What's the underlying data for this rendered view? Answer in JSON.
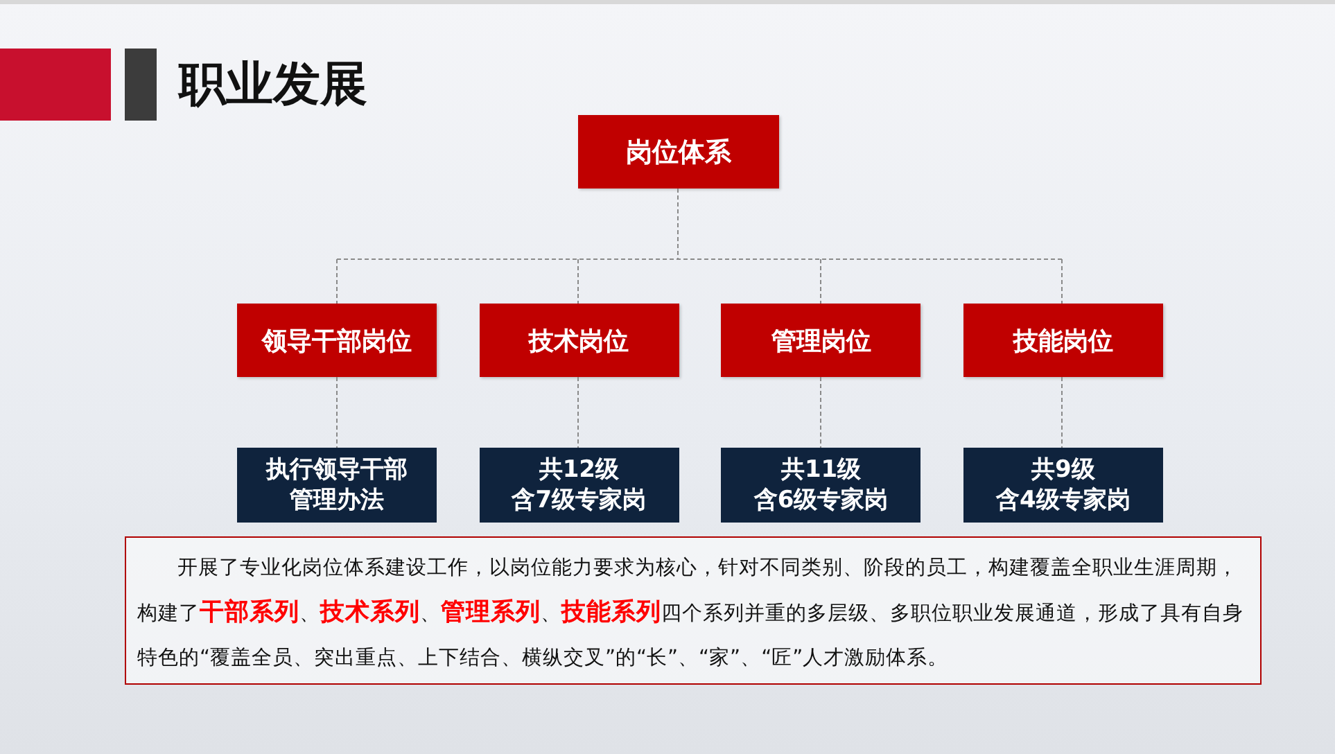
{
  "title": "职业发展",
  "root": "岗位体系",
  "branches": [
    {
      "label": "领导干部岗位",
      "detail": [
        "执行领导干部",
        "管理办法"
      ]
    },
    {
      "label": "技术岗位",
      "detail": [
        "共12级",
        "含7级专家岗"
      ]
    },
    {
      "label": "管理岗位",
      "detail": [
        "共11级",
        "含6级专家岗"
      ]
    },
    {
      "label": "技能岗位",
      "detail": [
        "共9级",
        "含4级专家岗"
      ]
    }
  ],
  "paragraph": "开展了专业化岗位体系建设工作，以岗位能力要求为核心，针对不同类别、阶段的员工，构建覆盖全职业生涯周期，构建了**干部系列**、**技术系列**、**管理系列**、**技能系列**四个系列并重的多层级、多职位职业发展通道，形成了具有自身特色的“覆盖全员、突出重点、上下结合、横纵交叉”的“长”、“家”、“匠”人才激励体系。"
}
